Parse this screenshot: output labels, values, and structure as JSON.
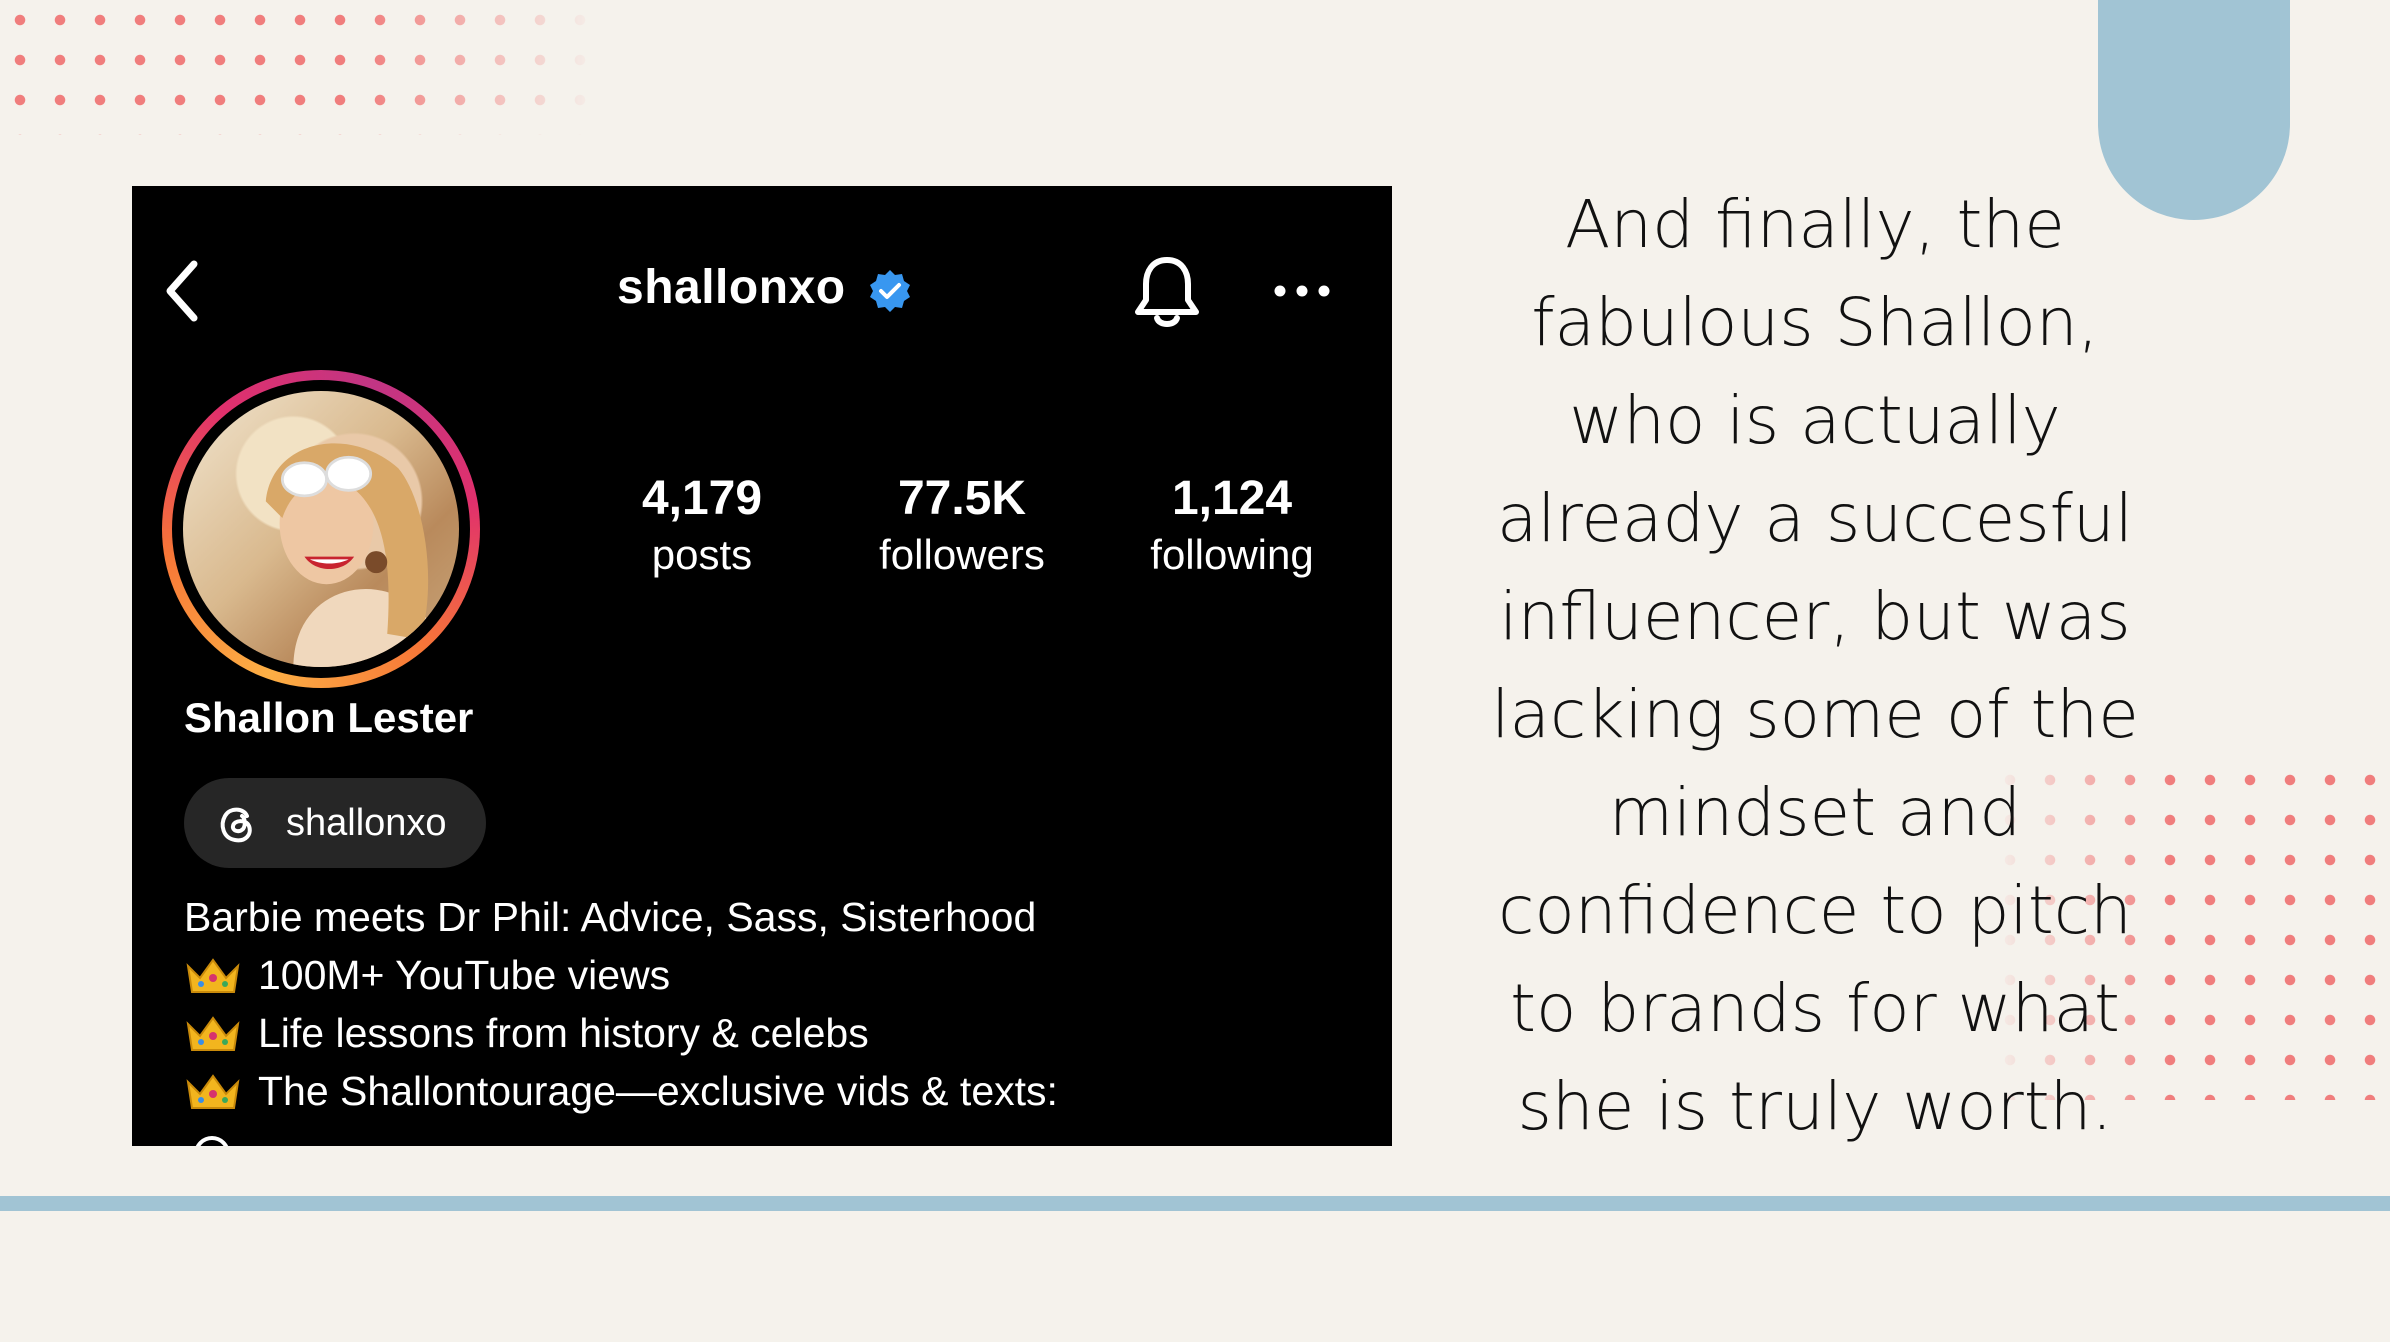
{
  "profile": {
    "username": "shallonxo",
    "display_name": "Shallon Lester",
    "verified": true,
    "stats": [
      {
        "value": "4,179",
        "label": "posts"
      },
      {
        "value": "77.5K",
        "label": "followers"
      },
      {
        "value": "1,124",
        "label": "following"
      }
    ],
    "threads_handle": "shallonxo",
    "bio": [
      "Barbie meets Dr Phil: Advice, Sass, Sisterhood",
      "100M+ YouTube views",
      "Life lessons from history & celebs",
      "The Shallontourage—exclusive vids & texts:"
    ],
    "icons": {
      "back": "chevron-left-icon",
      "verified": "verified-badge-icon",
      "notifications": "bell-icon",
      "more": "more-options-icon",
      "threads": "threads-icon",
      "bio_bullet": "crown-icon"
    }
  },
  "caption": {
    "lines": [
      "And finally, the",
      "fabulous Shallon,",
      "who is actually",
      "already a succesful",
      "influencer, but was",
      "lacking some of the",
      "mindset and",
      "confidence to pitch",
      "to brands for what",
      "she is truly worth."
    ]
  },
  "colors": {
    "background": "#f5f2ec",
    "accent_blue": "#a1c4d4",
    "dots": "#f06a6a",
    "verified": "#3897f0"
  }
}
